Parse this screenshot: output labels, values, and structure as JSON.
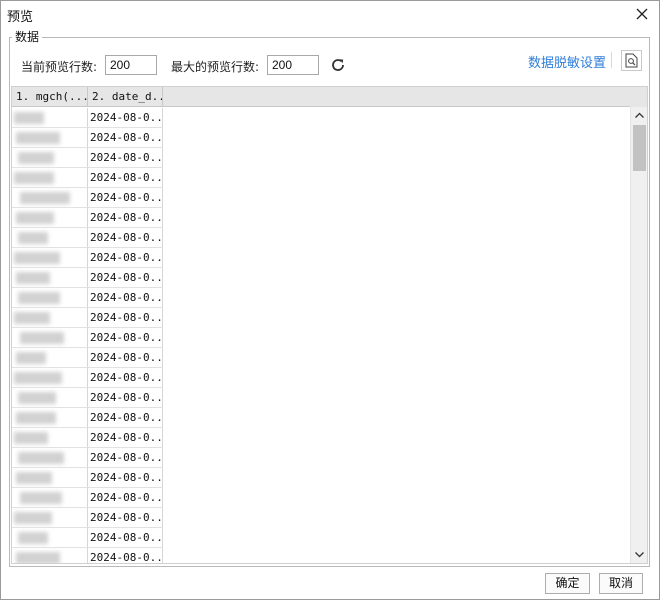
{
  "window": {
    "title": "预览",
    "close_icon": "close-icon"
  },
  "group": {
    "legend": "数据"
  },
  "toolbar": {
    "current_rows_label": "当前预览行数:",
    "current_rows_value": "200",
    "max_rows_label": "最大的预览行数:",
    "max_rows_value": "200",
    "refresh_icon": "refresh-icon",
    "mask_link": "数据脱敏设置",
    "preview_icon": "document-preview-icon",
    "link_color": "#2f7ed8"
  },
  "grid": {
    "columns": [
      "1. mgch(...",
      "2. date_d..."
    ],
    "rows": [
      "2024-08-0...",
      "2024-08-0...",
      "2024-08-0...",
      "2024-08-0...",
      "2024-08-0...",
      "2024-08-0...",
      "2024-08-0...",
      "2024-08-0...",
      "2024-08-0...",
      "2024-08-0...",
      "2024-08-0...",
      "2024-08-0...",
      "2024-08-0...",
      "2024-08-0...",
      "2024-08-0...",
      "2024-08-0...",
      "2024-08-0...",
      "2024-08-0...",
      "2024-08-0...",
      "2024-08-0...",
      "2024-08-0...",
      "2024-08-0...",
      "2024-08-0..."
    ],
    "first_column_note": "values blurred/redacted"
  },
  "footer": {
    "ok_label": "确定",
    "cancel_label": "取消"
  }
}
